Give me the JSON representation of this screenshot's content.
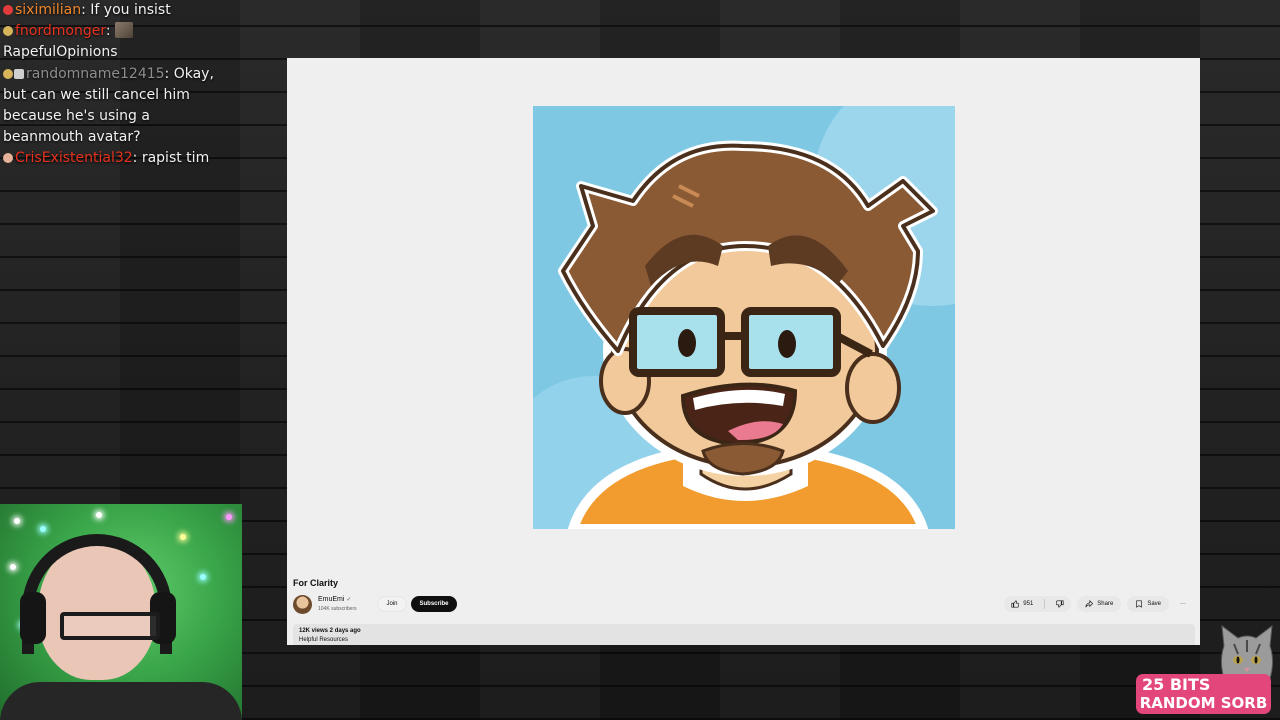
{
  "chat": {
    "messages": [
      {
        "user": "siximilian",
        "text": ": If you insist"
      },
      {
        "user": "fnordmonger",
        "text": ":",
        "emote": "emote-thumbnail",
        "continuation": "RapefulOpinions"
      },
      {
        "user": "randomname12415",
        "text": ": Okay, but can we still cancel him because he's using a beanmouth avatar?"
      },
      {
        "user": "CrisExistential32",
        "text": ": rapist tim"
      }
    ]
  },
  "video": {
    "title": "For Clarity",
    "channel_name": "EmuEmi",
    "verified_mark": "✓",
    "subscribers": "104K subscribers",
    "join_label": "Join",
    "subscribe_label": "Subscribe",
    "likes": "951",
    "share_label": "Share",
    "save_label": "Save",
    "more_label": "···",
    "views_date": "12K views  2 days ago",
    "description_preview": "Helpful Resources"
  },
  "alert": {
    "line1": "25 BITS",
    "line2": "RANDOM SORB"
  },
  "icons": {
    "like": "thumbs-up-icon",
    "dislike": "thumbs-down-icon",
    "share": "share-icon",
    "save": "bookmark-icon",
    "more": "more-icon",
    "verified": "verified-icon"
  },
  "colors": {
    "username_siximilian": "#f0872c",
    "username_fnordmonger": "#e8321e",
    "username_randomname": "#8e8e8e",
    "username_crisexistential": "#e8321e",
    "alert_bg": "#e2467a",
    "thumbnail_bg": "#7fc8e4",
    "subscribe_bg": "#0f0f0f"
  }
}
